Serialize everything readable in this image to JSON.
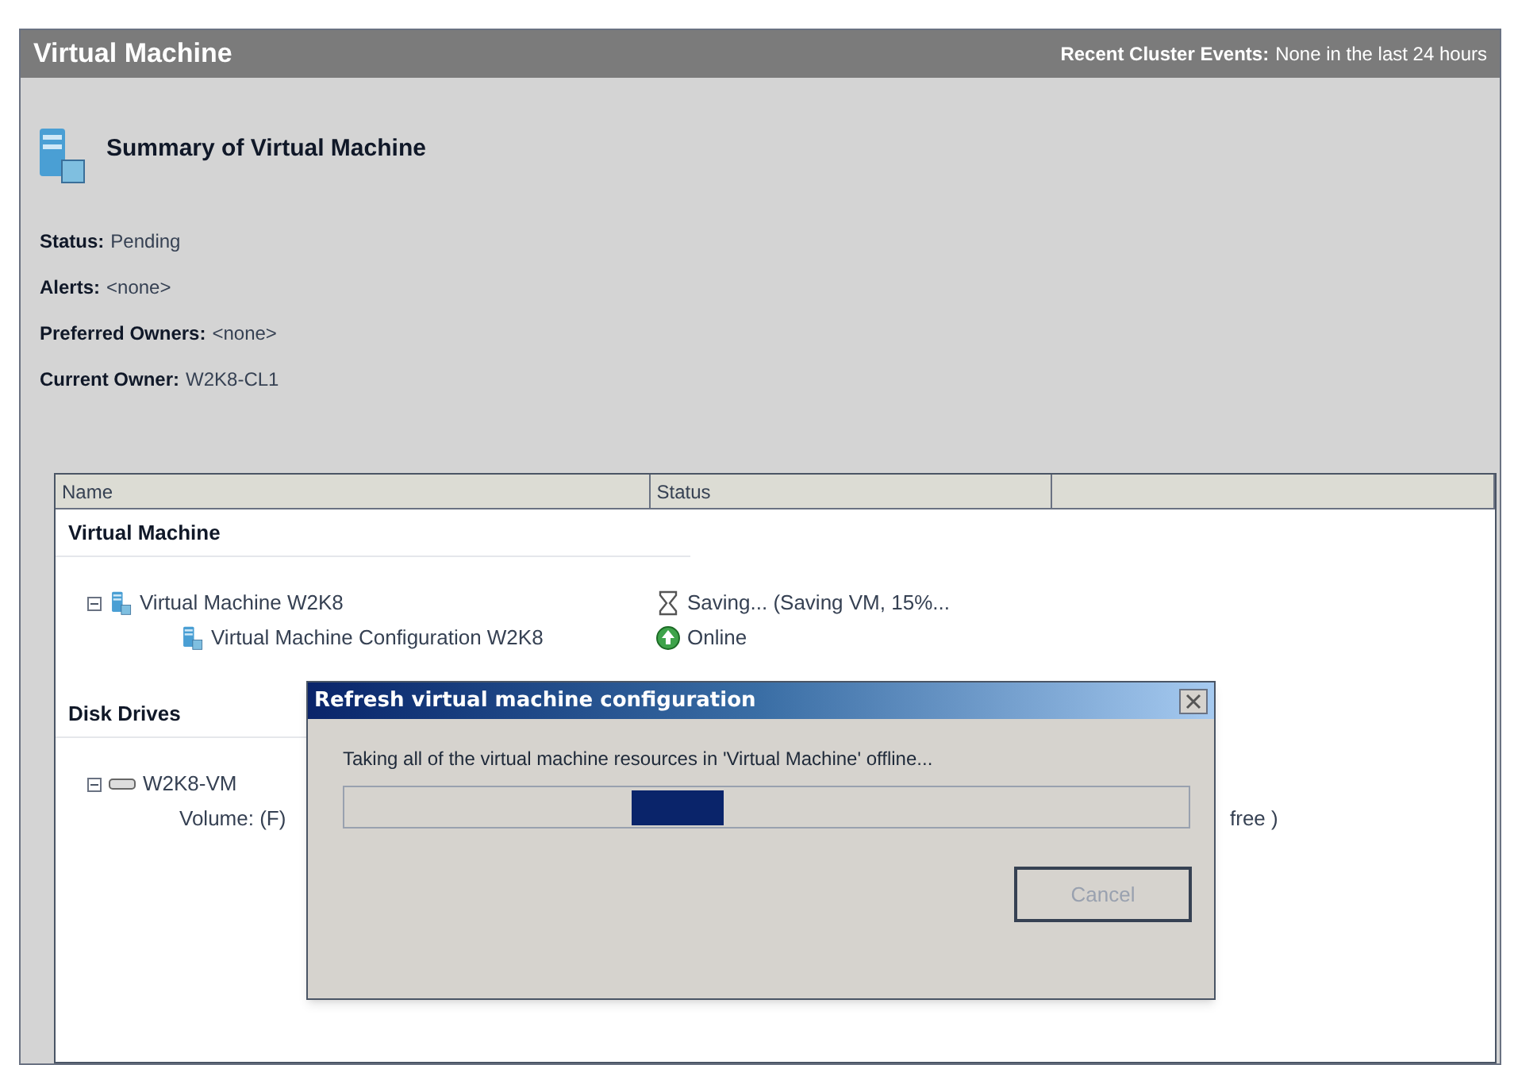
{
  "header": {
    "title": "Virtual Machine",
    "events_label": "Recent Cluster Events:",
    "events_value": "None in the last 24 hours"
  },
  "summary": {
    "title": "Summary of Virtual Machine",
    "fields": [
      {
        "label": "Status:",
        "value": "Pending"
      },
      {
        "label": "Alerts:",
        "value": "<none>"
      },
      {
        "label": "Preferred Owners:",
        "value": "<none>"
      },
      {
        "label": "Current Owner:",
        "value": "W2K8-CL1"
      }
    ]
  },
  "table": {
    "columns": [
      "Name",
      "Status"
    ],
    "groups": [
      {
        "title": "Virtual Machine",
        "rows": [
          {
            "kind": "vm",
            "name": "Virtual Machine W2K8",
            "status": {
              "kind": "pending",
              "text": "Saving... (Saving VM, 15%..."
            },
            "expanded": true
          },
          {
            "kind": "config",
            "name": "Virtual Machine Configuration W2K8",
            "status": {
              "kind": "online",
              "text": "Online"
            }
          }
        ]
      },
      {
        "title": "Disk Drives",
        "rows": [
          {
            "kind": "disk",
            "name": "W2K8-VM",
            "expanded": true
          },
          {
            "kind": "volume",
            "name": "Volume: (F)",
            "status": {
              "kind": "plain",
              "text": "free )"
            }
          }
        ]
      }
    ]
  },
  "dialog": {
    "title": "Refresh virtual machine configuration",
    "message": "Taking all of the virtual machine resources in 'Virtual Machine' offline...",
    "progress": {
      "level": 0.45
    },
    "button": {
      "label": "Cancel",
      "disabled": true
    }
  }
}
